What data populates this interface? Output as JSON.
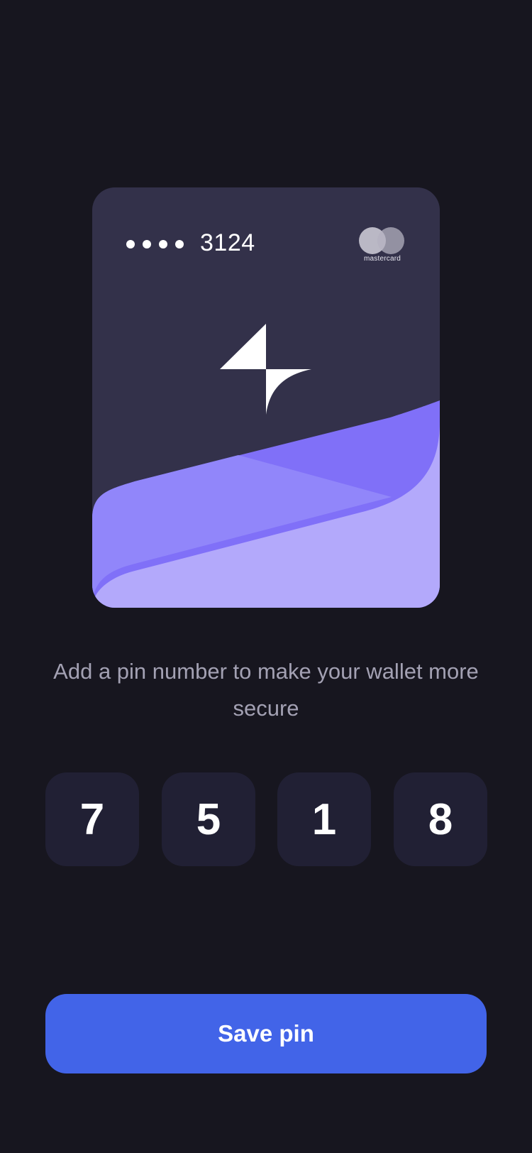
{
  "card": {
    "masked_digits": "••••",
    "last_four": "3124",
    "brand_logo_text": "mastercard",
    "center_icon": "sparkle-star-icon",
    "colors": {
      "background": "#33314a",
      "wave_dark": "#8070f8",
      "wave_mid": "#9186fa",
      "wave_light": "#b3a9fb"
    }
  },
  "message": "Add a pin number to make your wallet more secure",
  "pin": {
    "digits": [
      "7",
      "5",
      "1",
      "8"
    ]
  },
  "save_button": {
    "label": "Save pin",
    "color": "#4264e8"
  },
  "colors": {
    "page_background": "#17161f",
    "pin_box": "#212034",
    "message_text": "#a3a1b3"
  }
}
